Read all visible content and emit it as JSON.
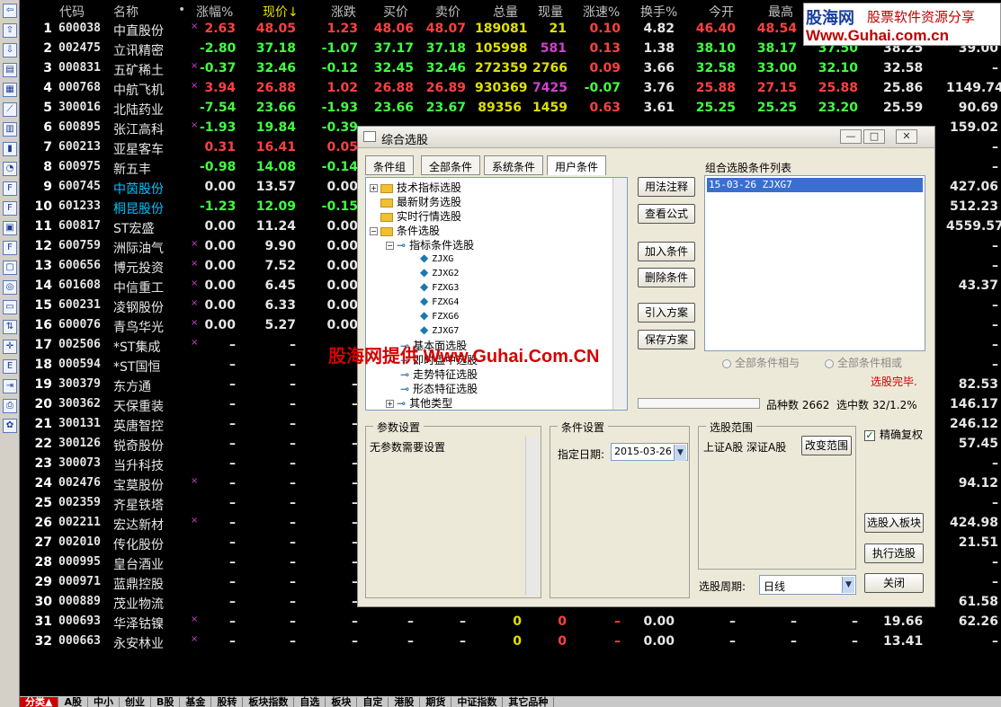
{
  "toolbar_icons": [
    "back-icon",
    "up-icon",
    "down-icon",
    "report-icon",
    "grid-icon",
    "chart-icon",
    "table-icon",
    "candle-icon",
    "dashboard-icon",
    "fa-icon",
    "f10-icon",
    "news-icon",
    "f2-icon",
    "screen-icon",
    "circle-icon",
    "folder-icon",
    "arrow-icon",
    "target-icon",
    "etf-icon",
    "export-icon",
    "print-icon",
    "gear-icon"
  ],
  "columns": [
    "代码",
    "名称",
    "•",
    "涨幅%",
    "现价↓",
    "涨跌",
    "买价",
    "卖价",
    "总量",
    "现量",
    "涨速%",
    "换手%",
    "今开",
    "最高"
  ],
  "rows": [
    {
      "i": "1",
      "code": "600038",
      "name": "中直股份",
      "mark": "×",
      "chg": "2.63",
      "price": "48.05",
      "diff": "1.23",
      "buy": "48.06",
      "sell": "48.07",
      "vol": "189081",
      "cur": "21",
      "spd": "0.10",
      "turn": "4.82",
      "open": "46.40",
      "high": "48.54",
      "x1": "",
      "x2": "",
      "x3": "",
      "d": "up"
    },
    {
      "i": "2",
      "code": "002475",
      "name": "立讯精密",
      "mark": "",
      "chg": "-2.80",
      "price": "37.18",
      "diff": "-1.07",
      "buy": "37.17",
      "sell": "37.18",
      "vol": "105998",
      "cur": "581",
      "spd": "0.13",
      "turn": "1.38",
      "open": "38.10",
      "high": "38.17",
      "x1": "37.50",
      "x2": "38.25",
      "x3": "39.00",
      "d": "dn"
    },
    {
      "i": "3",
      "code": "000831",
      "name": "五矿稀土",
      "mark": "×",
      "chg": "-0.37",
      "price": "32.46",
      "diff": "-0.12",
      "buy": "32.45",
      "sell": "32.46",
      "vol": "272359",
      "cur": "2766",
      "spd": "0.09",
      "turn": "3.66",
      "open": "32.58",
      "high": "33.00",
      "x1": "32.10",
      "x2": "32.58",
      "x3": "–",
      "d": "dn"
    },
    {
      "i": "4",
      "code": "000768",
      "name": "中航飞机",
      "mark": "×",
      "chg": "3.94",
      "price": "26.88",
      "diff": "1.02",
      "buy": "26.88",
      "sell": "26.89",
      "vol": "930369",
      "cur": "7425",
      "spd": "-0.07",
      "turn": "3.76",
      "open": "25.88",
      "high": "27.15",
      "x1": "25.88",
      "x2": "25.86",
      "x3": "1149.74",
      "d": "up"
    },
    {
      "i": "5",
      "code": "300016",
      "name": "北陆药业",
      "mark": "",
      "chg": "-7.54",
      "price": "23.66",
      "diff": "-1.93",
      "buy": "23.66",
      "sell": "23.67",
      "vol": "89356",
      "cur": "1459",
      "spd": "0.63",
      "turn": "3.61",
      "open": "25.25",
      "high": "25.25",
      "x1": "23.20",
      "x2": "25.59",
      "x3": "90.69",
      "d": "dn"
    },
    {
      "i": "6",
      "code": "600895",
      "name": "张江高科",
      "mark": "×",
      "chg": "-1.93",
      "price": "19.84",
      "diff": "-0.39",
      "buy": "",
      "sell": "",
      "vol": "",
      "cur": "",
      "spd": "",
      "turn": "",
      "open": "",
      "high": "",
      "x1": "",
      "x2": "",
      "x3": "159.02",
      "d": "dn"
    },
    {
      "i": "7",
      "code": "600213",
      "name": "亚星客车",
      "mark": "",
      "chg": "0.31",
      "price": "16.41",
      "diff": "0.05",
      "buy": "",
      "sell": "",
      "vol": "",
      "cur": "",
      "spd": "",
      "turn": "",
      "open": "",
      "high": "",
      "x1": "",
      "x2": "",
      "x3": "–",
      "d": "up"
    },
    {
      "i": "8",
      "code": "600975",
      "name": "新五丰",
      "mark": "",
      "chg": "-0.98",
      "price": "14.08",
      "diff": "-0.14",
      "buy": "",
      "sell": "",
      "vol": "",
      "cur": "",
      "spd": "",
      "turn": "",
      "open": "",
      "high": "",
      "x1": "",
      "x2": "",
      "x3": "–",
      "d": "dn"
    },
    {
      "i": "9",
      "code": "600745",
      "name": "中茵股份",
      "mark": "",
      "chg": "0.00",
      "price": "13.57",
      "diff": "0.00",
      "buy": "",
      "sell": "",
      "vol": "",
      "cur": "",
      "spd": "",
      "turn": "",
      "open": "",
      "high": "",
      "x1": "",
      "x2": "",
      "x3": "427.06",
      "d": "wh",
      "nc": "cy"
    },
    {
      "i": "10",
      "code": "601233",
      "name": "桐昆股份",
      "mark": "",
      "chg": "-1.23",
      "price": "12.09",
      "diff": "-0.15",
      "buy": "",
      "sell": "",
      "vol": "",
      "cur": "",
      "spd": "",
      "turn": "",
      "open": "",
      "high": "",
      "x1": "",
      "x2": "",
      "x3": "512.23",
      "d": "dn",
      "nc": "cy"
    },
    {
      "i": "11",
      "code": "600817",
      "name": "ST宏盛",
      "mark": "",
      "chg": "0.00",
      "price": "11.24",
      "diff": "0.00",
      "buy": "",
      "sell": "",
      "vol": "",
      "cur": "",
      "spd": "",
      "turn": "",
      "open": "",
      "high": "",
      "x1": "",
      "x2": "",
      "x3": "4559.57",
      "d": "wh"
    },
    {
      "i": "12",
      "code": "600759",
      "name": "洲际油气",
      "mark": "×",
      "chg": "0.00",
      "price": "9.90",
      "diff": "0.00",
      "buy": "",
      "sell": "",
      "vol": "",
      "cur": "",
      "spd": "",
      "turn": "",
      "open": "",
      "high": "",
      "x1": "",
      "x2": "",
      "x3": "–",
      "d": "wh"
    },
    {
      "i": "13",
      "code": "600656",
      "name": "博元投资",
      "mark": "×",
      "chg": "0.00",
      "price": "7.52",
      "diff": "0.00",
      "buy": "",
      "sell": "",
      "vol": "",
      "cur": "",
      "spd": "",
      "turn": "",
      "open": "",
      "high": "",
      "x1": "",
      "x2": "",
      "x3": "–",
      "d": "wh"
    },
    {
      "i": "14",
      "code": "601608",
      "name": "中信重工",
      "mark": "×",
      "chg": "0.00",
      "price": "6.45",
      "diff": "0.00",
      "buy": "",
      "sell": "",
      "vol": "",
      "cur": "",
      "spd": "",
      "turn": "",
      "open": "",
      "high": "",
      "x1": "",
      "x2": "",
      "x3": "43.37",
      "d": "wh"
    },
    {
      "i": "15",
      "code": "600231",
      "name": "凌钢股份",
      "mark": "×",
      "chg": "0.00",
      "price": "6.33",
      "diff": "0.00",
      "buy": "",
      "sell": "",
      "vol": "",
      "cur": "",
      "spd": "",
      "turn": "",
      "open": "",
      "high": "",
      "x1": "",
      "x2": "",
      "x3": "–",
      "d": "wh"
    },
    {
      "i": "16",
      "code": "600076",
      "name": "青鸟华光",
      "mark": "×",
      "chg": "0.00",
      "price": "5.27",
      "diff": "0.00",
      "buy": "",
      "sell": "",
      "vol": "",
      "cur": "",
      "spd": "",
      "turn": "",
      "open": "",
      "high": "",
      "x1": "",
      "x2": "",
      "x3": "–",
      "d": "wh"
    },
    {
      "i": "17",
      "code": "002506",
      "name": "*ST集成",
      "mark": "×",
      "chg": "–",
      "price": "–",
      "diff": "",
      "buy": "",
      "sell": "",
      "vol": "",
      "cur": "",
      "spd": "",
      "turn": "",
      "open": "",
      "high": "",
      "x1": "",
      "x2": "",
      "x3": "–",
      "d": "wh"
    },
    {
      "i": "18",
      "code": "000594",
      "name": "*ST国恒",
      "mark": "",
      "chg": "–",
      "price": "–",
      "diff": "",
      "buy": "",
      "sell": "",
      "vol": "",
      "cur": "",
      "spd": "",
      "turn": "",
      "open": "",
      "high": "",
      "x1": "",
      "x2": "",
      "x3": "–",
      "d": "wh"
    },
    {
      "i": "19",
      "code": "300379",
      "name": "东方通",
      "mark": "",
      "chg": "–",
      "price": "–",
      "diff": "–",
      "buy": "",
      "sell": "",
      "vol": "",
      "cur": "",
      "spd": "",
      "turn": "",
      "open": "",
      "high": "",
      "x1": "",
      "x2": "",
      "x3": "82.53",
      "d": "wh"
    },
    {
      "i": "20",
      "code": "300362",
      "name": "天保重装",
      "mark": "",
      "chg": "–",
      "price": "–",
      "diff": "–",
      "buy": "",
      "sell": "",
      "vol": "",
      "cur": "",
      "spd": "",
      "turn": "",
      "open": "",
      "high": "",
      "x1": "",
      "x2": "",
      "x3": "146.17",
      "d": "wh"
    },
    {
      "i": "21",
      "code": "300131",
      "name": "英唐智控",
      "mark": "",
      "chg": "–",
      "price": "–",
      "diff": "–",
      "buy": "",
      "sell": "",
      "vol": "",
      "cur": "",
      "spd": "",
      "turn": "",
      "open": "",
      "high": "",
      "x1": "",
      "x2": "",
      "x3": "246.12",
      "d": "wh"
    },
    {
      "i": "22",
      "code": "300126",
      "name": "锐奇股份",
      "mark": "",
      "chg": "–",
      "price": "–",
      "diff": "–",
      "buy": "",
      "sell": "",
      "vol": "",
      "cur": "",
      "spd": "",
      "turn": "",
      "open": "",
      "high": "",
      "x1": "",
      "x2": "",
      "x3": "57.45",
      "d": "wh"
    },
    {
      "i": "23",
      "code": "300073",
      "name": "当升科技",
      "mark": "",
      "chg": "–",
      "price": "–",
      "diff": "–",
      "buy": "",
      "sell": "",
      "vol": "",
      "cur": "",
      "spd": "",
      "turn": "",
      "open": "",
      "high": "",
      "x1": "",
      "x2": "",
      "x3": "–",
      "d": "wh"
    },
    {
      "i": "24",
      "code": "002476",
      "name": "宝莫股份",
      "mark": "×",
      "chg": "–",
      "price": "–",
      "diff": "–",
      "buy": "",
      "sell": "",
      "vol": "",
      "cur": "",
      "spd": "",
      "turn": "",
      "open": "",
      "high": "",
      "x1": "",
      "x2": "",
      "x3": "94.12",
      "d": "wh"
    },
    {
      "i": "25",
      "code": "002359",
      "name": "齐星铁塔",
      "mark": "",
      "chg": "–",
      "price": "–",
      "diff": "–",
      "buy": "",
      "sell": "",
      "vol": "",
      "cur": "",
      "spd": "",
      "turn": "",
      "open": "",
      "high": "",
      "x1": "",
      "x2": "",
      "x3": "–",
      "d": "wh"
    },
    {
      "i": "26",
      "code": "002211",
      "name": "宏达新材",
      "mark": "×",
      "chg": "–",
      "price": "–",
      "diff": "–",
      "buy": "",
      "sell": "",
      "vol": "",
      "cur": "",
      "spd": "",
      "turn": "",
      "open": "",
      "high": "",
      "x1": "",
      "x2": "",
      "x3": "424.98",
      "d": "wh"
    },
    {
      "i": "27",
      "code": "002010",
      "name": "传化股份",
      "mark": "",
      "chg": "–",
      "price": "–",
      "diff": "–",
      "buy": "",
      "sell": "",
      "vol": "",
      "cur": "",
      "spd": "",
      "turn": "",
      "open": "",
      "high": "",
      "x1": "",
      "x2": "",
      "x3": "21.51",
      "d": "wh"
    },
    {
      "i": "28",
      "code": "000995",
      "name": "皇台酒业",
      "mark": "",
      "chg": "–",
      "price": "–",
      "diff": "–",
      "buy": "",
      "sell": "",
      "vol": "",
      "cur": "",
      "spd": "",
      "turn": "",
      "open": "",
      "high": "",
      "x1": "",
      "x2": "",
      "x3": "–",
      "d": "wh"
    },
    {
      "i": "29",
      "code": "000971",
      "name": "蓝鼎控股",
      "mark": "",
      "chg": "–",
      "price": "–",
      "diff": "–",
      "buy": "",
      "sell": "",
      "vol": "",
      "cur": "",
      "spd": "",
      "turn": "",
      "open": "",
      "high": "",
      "x1": "",
      "x2": "",
      "x3": "–",
      "d": "wh"
    },
    {
      "i": "30",
      "code": "000889",
      "name": "茂业物流",
      "mark": "",
      "chg": "–",
      "price": "–",
      "diff": "–",
      "buy": "",
      "sell": "",
      "vol": "",
      "cur": "",
      "spd": "",
      "turn": "",
      "open": "",
      "high": "",
      "x1": "",
      "x2": "",
      "x3": "61.58",
      "d": "wh"
    },
    {
      "i": "31",
      "code": "000693",
      "name": "华泽钴镍",
      "mark": "×",
      "chg": "–",
      "price": "–",
      "diff": "–",
      "buy": "–",
      "sell": "–",
      "vol": "0",
      "cur": "0",
      "spd": "–",
      "turn": "0.00",
      "open": "–",
      "high": "–",
      "x1": "–",
      "x2": "19.66",
      "x3": "62.26",
      "d": "wh"
    },
    {
      "i": "32",
      "code": "000663",
      "name": "永安林业",
      "mark": "×",
      "chg": "–",
      "price": "–",
      "diff": "–",
      "buy": "–",
      "sell": "–",
      "vol": "0",
      "cur": "0",
      "spd": "–",
      "turn": "0.00",
      "open": "–",
      "high": "–",
      "x1": "–",
      "x2": "13.41",
      "x3": "–",
      "d": "wh"
    }
  ],
  "statusbar": [
    "分类▲",
    "A股",
    "中小",
    "创业",
    "B股",
    "基金",
    "股转",
    "板块指数",
    "自选",
    "板块",
    "自定",
    "港股",
    "期货",
    "中证指数",
    "其它品种"
  ],
  "logo": {
    "name": "股海网",
    "slogan": "股票软件资源分享",
    "url": "Www.Guhai.com.cn"
  },
  "watermark": "股海网提供 Www.Guhai.Com.CN",
  "dialog": {
    "title": "综合选股",
    "tabs": [
      "条件组",
      "全部条件",
      "系统条件",
      "用户条件"
    ],
    "tree": {
      "folders": [
        "技术指标选股",
        "最新财务选股",
        "实时行情选股",
        "条件选股"
      ],
      "sub": "指标条件选股",
      "leaves": [
        "ZJXG",
        "ZJXG2",
        "FZXG3",
        "FZXG4",
        "FZXG6",
        "ZJXG7"
      ],
      "more": [
        "基本面选股",
        "即时盘中选股",
        "走势特征选股",
        "形态特征选股",
        "其他类型"
      ]
    },
    "buttons": {
      "usage": "用法注释",
      "formula": "查看公式",
      "add": "加入条件",
      "del": "删除条件",
      "import": "引入方案",
      "save": "保存方案",
      "to_block": "选股入板块",
      "run": "执行选股",
      "close": "关闭",
      "range": "改变范围"
    },
    "list_title": "组合选股条件列表",
    "list_item": "15-03-26 ZJXG7",
    "radio_and": "全部条件相与",
    "radio_or": "全部条件相或",
    "done": "选股完毕.",
    "count_label": "品种数",
    "count": "2662",
    "selected_label": "选中数",
    "selected": "32/1.2%",
    "param_title": "参数设置",
    "param_text": "无参数需要设置",
    "cond_title": "条件设置",
    "date_label": "指定日期:",
    "date": "2015-03-26",
    "range_title": "选股范围",
    "range_text": "上证A股 深证A股",
    "exact": "精确复权",
    "period_label": "选股周期:",
    "period": "日线"
  }
}
